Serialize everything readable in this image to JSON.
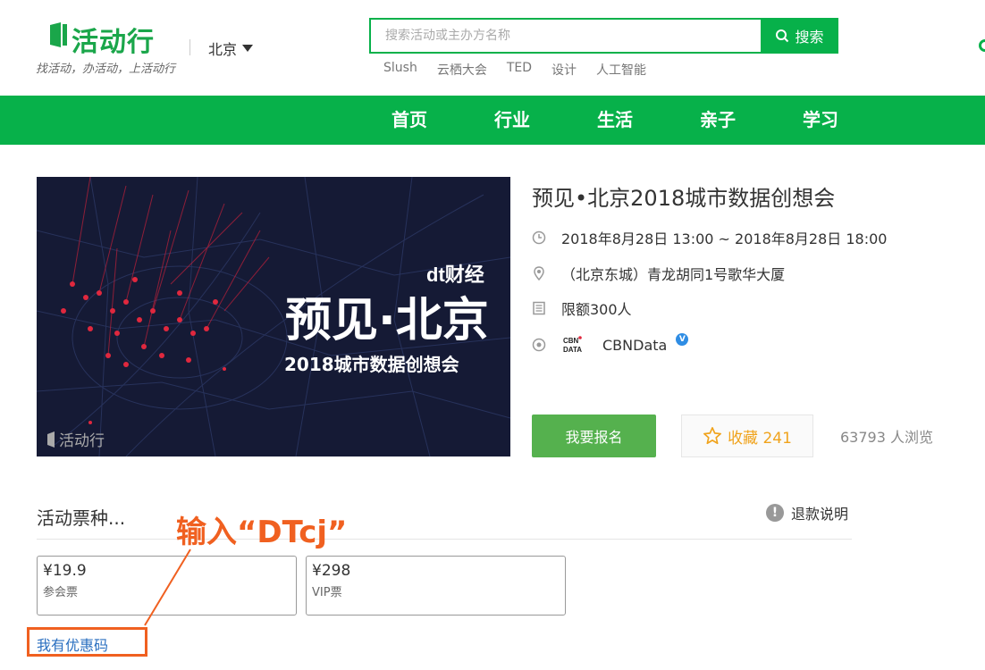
{
  "header": {
    "logo_text": "活动行",
    "slogan": "找活动，办活动，上活动行",
    "city": "北京",
    "search": {
      "placeholder": "搜索活动或主办方名称",
      "button_label": "搜索"
    },
    "hot_tags": [
      "Slush",
      "云栖大会",
      "TED",
      "设计",
      "人工智能"
    ]
  },
  "nav": {
    "items": [
      "首页",
      "行业",
      "生活",
      "亲子",
      "学习"
    ]
  },
  "banner": {
    "brand": "dt财经",
    "title": "预见·北京",
    "subtitle": "2018城市数据创想会",
    "watermark": "活动行"
  },
  "event": {
    "title": "预见•北京2018城市数据创想会",
    "time": "2018年8月28日 13:00  ~  2018年8月28日 18:00",
    "location": "（北京东城）青龙胡同1号歌华大厦",
    "capacity": "限额300人",
    "organizer_logo": "CBN DATA",
    "organizer": "CBNData",
    "verified_badge": "V"
  },
  "actions": {
    "signup_label": "我要报名",
    "favorite_label": "收藏 241",
    "views": "63793 人浏览"
  },
  "tickets": {
    "section_title": "活动票种...",
    "refund_icon": "!",
    "refund_label": "退款说明",
    "items": [
      {
        "price": "¥19.9",
        "name": "参会票"
      },
      {
        "price": "¥298",
        "name": "VIP票"
      }
    ],
    "coupon_label": "我有优惠码"
  },
  "annotation": {
    "text": "输入“DTcj”",
    "color": "#f06020"
  },
  "colors": {
    "brand_green": "#07b14a",
    "signup_green": "#55b14e",
    "favorite_orange": "#f0a31c",
    "link_blue": "#2a6fc0"
  }
}
